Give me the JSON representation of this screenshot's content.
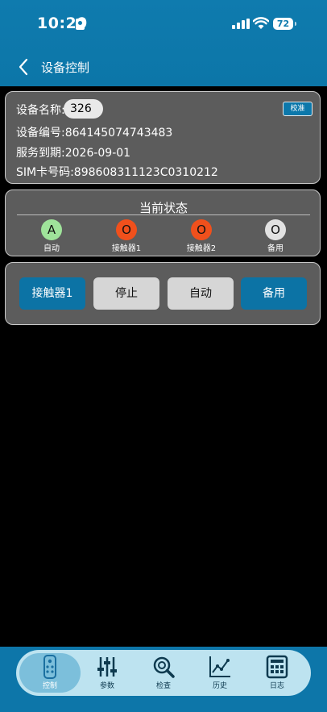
{
  "status_bar": {
    "time": "10:29",
    "battery": "72"
  },
  "header": {
    "title": "设备控制"
  },
  "device": {
    "name_label": "设备名称:",
    "name_value": "326",
    "calibrate_label": "校准",
    "code_line": "设备编号:864145074743483",
    "expiry_line": "服务到期:2026-09-01",
    "sim_line": "SIM卡号码:898608311123C0310212"
  },
  "status": {
    "title": "当前状态",
    "indicators": [
      {
        "symbol": "A",
        "label": "自动",
        "color": "#9fe39a"
      },
      {
        "symbol": "O",
        "label": "接触器1",
        "color": "#f0501c"
      },
      {
        "symbol": "O",
        "label": "接触器2",
        "color": "#f0501c"
      },
      {
        "symbol": "O",
        "label": "备用",
        "color": "#e2e2e2"
      }
    ]
  },
  "controls": {
    "buttons": [
      "接触器1",
      "停止",
      "自动",
      "备用"
    ]
  },
  "tabs": [
    "控制",
    "参数",
    "检查",
    "历史",
    "日志"
  ],
  "colors": {
    "accent": "#0f7bae",
    "tab_bg": "#bde3f0",
    "panel": "#5c5c5c"
  }
}
